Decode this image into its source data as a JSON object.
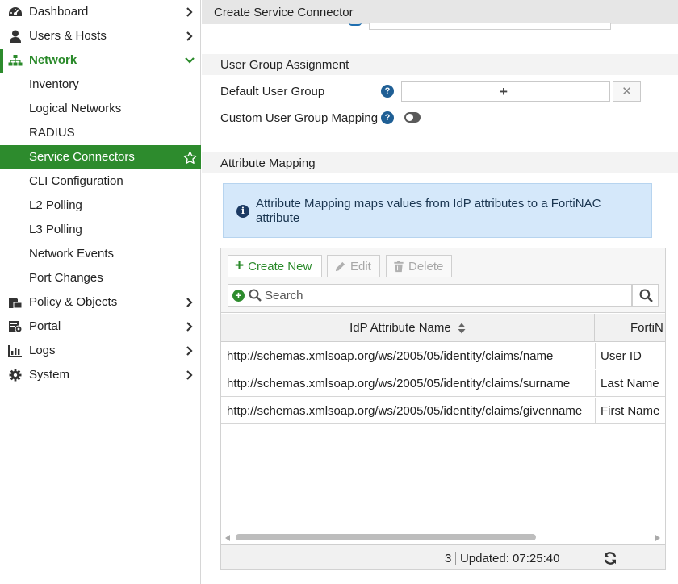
{
  "sidebar": {
    "items": [
      {
        "label": "Dashboard",
        "icon": "dashboard-icon"
      },
      {
        "label": "Users & Hosts",
        "icon": "user-icon"
      },
      {
        "label": "Network",
        "icon": "network-icon"
      },
      {
        "label": "Inventory"
      },
      {
        "label": "Logical Networks"
      },
      {
        "label": "RADIUS"
      },
      {
        "label": "Service Connectors"
      },
      {
        "label": "CLI Configuration"
      },
      {
        "label": "L2 Polling"
      },
      {
        "label": "L3 Polling"
      },
      {
        "label": "Network Events"
      },
      {
        "label": "Port Changes"
      },
      {
        "label": "Policy & Objects",
        "icon": "policy-icon"
      },
      {
        "label": "Portal",
        "icon": "portal-icon"
      },
      {
        "label": "Logs",
        "icon": "logs-icon"
      },
      {
        "label": "System",
        "icon": "gear-icon"
      }
    ],
    "accent_color": "#2d8b2d"
  },
  "header": {
    "title": "Create Service Connector"
  },
  "user_group": {
    "section_title": "User Group Assignment",
    "default_label": "Default User Group",
    "add_symbol": "+",
    "clear_symbol": "✕",
    "custom_label": "Custom User Group Mapping",
    "custom_enabled": false
  },
  "attribute_mapping": {
    "section_title": "Attribute Mapping",
    "info_text": "Attribute Mapping maps values from IdP attributes to a FortiNAC attribute",
    "toolbar": {
      "create_label": "Create New",
      "edit_label": "Edit",
      "delete_label": "Delete"
    },
    "search": {
      "placeholder": "Search"
    },
    "columns": [
      "IdP Attribute Name",
      "FortiN"
    ],
    "rows": [
      {
        "idp": "http://schemas.xmlsoap.org/ws/2005/05/identity/claims/name",
        "forti": "User ID"
      },
      {
        "idp": "http://schemas.xmlsoap.org/ws/2005/05/identity/claims/surname",
        "forti": "Last Name"
      },
      {
        "idp": "http://schemas.xmlsoap.org/ws/2005/05/identity/claims/givenname",
        "forti": "First Name"
      }
    ],
    "footer": {
      "count": "3",
      "updated": "Updated: 07:25:40"
    }
  }
}
